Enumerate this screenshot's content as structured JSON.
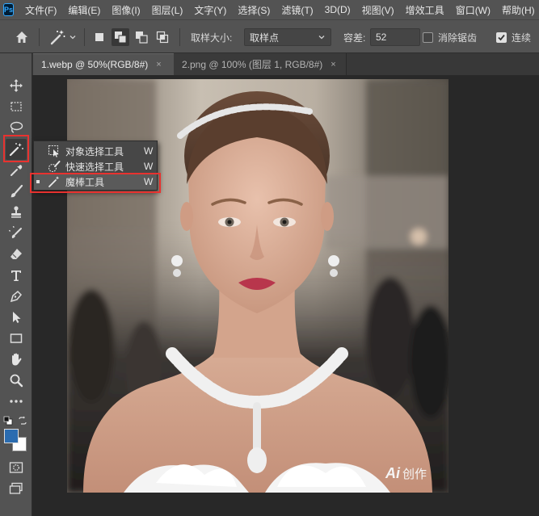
{
  "app": {
    "logo_text": "Ps"
  },
  "menubar": {
    "items": [
      "文件(F)",
      "编辑(E)",
      "图像(I)",
      "图层(L)",
      "文字(Y)",
      "选择(S)",
      "滤镜(T)",
      "3D(D)",
      "视图(V)",
      "增效工具",
      "窗口(W)",
      "帮助(H)"
    ]
  },
  "options": {
    "sample_size_label": "取样大小:",
    "sample_size_value": "取样点",
    "tolerance_label": "容差:",
    "tolerance_value": "52",
    "anti_alias_label": "消除锯齿",
    "anti_alias_checked": false,
    "contiguous_label": "连续",
    "contiguous_checked": true
  },
  "tabs": [
    {
      "label": "1.webp @ 50%(RGB/8#)",
      "active": true
    },
    {
      "label": "2.png @ 100% (图层 1, RGB/8#)",
      "active": false
    }
  ],
  "tab_close_glyph": "×",
  "collapse_glyph": "»",
  "flyout": {
    "items": [
      {
        "label": "对象选择工具",
        "shortcut": "W",
        "selected": false
      },
      {
        "label": "快速选择工具",
        "shortcut": "W",
        "selected": false
      },
      {
        "label": "魔棒工具",
        "shortcut": "W",
        "selected": true
      }
    ]
  },
  "colors": {
    "foreground": "#2b6cb0",
    "background": "#ffffff",
    "highlight_box": "#e8322f"
  },
  "watermark": {
    "logo": "Ai",
    "text": "创作"
  }
}
